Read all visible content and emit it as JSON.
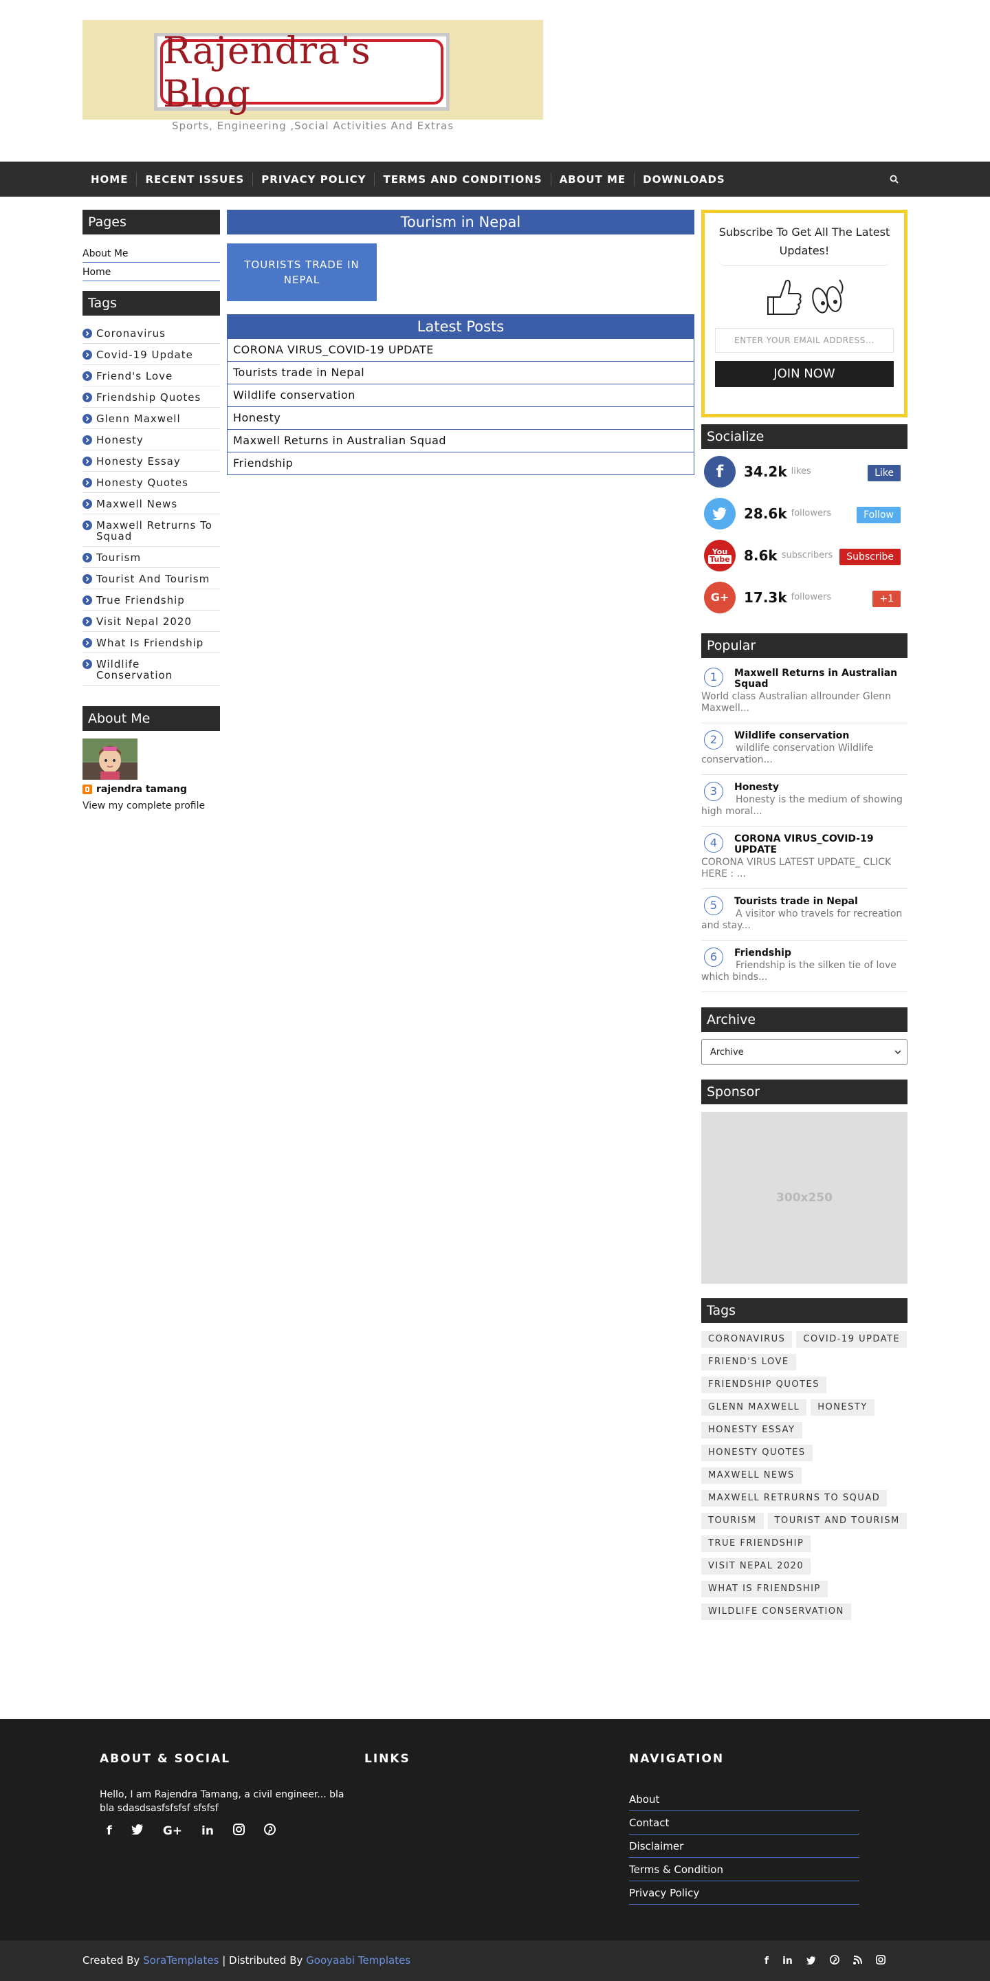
{
  "header": {
    "logo_text": "Rajendra's Blog",
    "tagline": "Sports, Engineering ,Social Activities And Extras"
  },
  "nav": {
    "items": [
      "HOME",
      "RECENT ISSUES",
      "PRIVACY POLICY",
      "TERMS AND CONDITIONS",
      "ABOUT ME",
      "DOWNLOADS"
    ],
    "search_icon": "search-icon"
  },
  "left": {
    "pages_title": "Pages",
    "pages": [
      "About Me",
      "Home"
    ],
    "tags_title": "Tags",
    "tags": [
      "Coronavirus",
      "Covid-19 Update",
      "Friend's Love",
      "Friendship Quotes",
      "Glenn Maxwell",
      "Honesty",
      "Honesty Essay",
      "Honesty Quotes",
      "Maxwell News",
      "Maxwell Retrurns To Squad",
      "Tourism",
      "Tourist And Tourism",
      "True Friendship",
      "Visit Nepal 2020",
      "What Is Friendship",
      "Wildlife Conservation"
    ],
    "about_title": "About Me",
    "profile_name": "rajendra tamang",
    "profile_link": "View my complete profile"
  },
  "center": {
    "title": "Tourism in Nepal",
    "post_card": "TOURISTS TRADE IN NEPAL",
    "latest_title": "Latest Posts",
    "latest": [
      "CORONA VIRUS_COVID-19 UPDATE",
      "Tourists trade in Nepal",
      "Wildlife conservation",
      "Honesty",
      "Maxwell Returns in Australian Squad",
      "Friendship"
    ]
  },
  "right": {
    "subscribe_text": "Subscribe To Get All The Latest Updates!",
    "email_placeholder": "ENTER YOUR EMAIL ADDRESS...",
    "join_label": "JOIN NOW",
    "socialize_title": "Socialize",
    "social": [
      {
        "icon": "facebook-icon",
        "count": "34.2k",
        "unit": "likes",
        "button": "Like",
        "color": "#3b5998",
        "btn_color": "#3b5998"
      },
      {
        "icon": "twitter-icon",
        "count": "28.6k",
        "unit": "followers",
        "button": "Follow",
        "color": "#55acee",
        "btn_color": "#55acee"
      },
      {
        "icon": "youtube-icon",
        "count": "8.6k",
        "unit": "subscribers",
        "button": "Subscribe",
        "color": "#cd201f",
        "btn_color": "#cd201f"
      },
      {
        "icon": "google-plus-icon",
        "count": "17.3k",
        "unit": "followers",
        "button": "+1",
        "color": "#dd4b39",
        "btn_color": "#dd4b39"
      }
    ],
    "popular_title": "Popular",
    "popular": [
      {
        "num": "1",
        "title": "Maxwell Returns in Australian Squad",
        "snippet": "World class Australian  allrounder Glenn Maxwell..."
      },
      {
        "num": "2",
        "title": "Wildlife conservation",
        "snippet": "wildlife conservation Wildlife conservation..."
      },
      {
        "num": "3",
        "title": "Honesty",
        "snippet": "Honesty is the medium of showing high moral..."
      },
      {
        "num": "4",
        "title": "CORONA VIRUS_COVID-19 UPDATE",
        "snippet": "CORONA VIRUS LATEST UPDATE_ CLICK HERE : ..."
      },
      {
        "num": "5",
        "title": "Tourists trade in Nepal",
        "snippet": "A visitor who travels for recreation and stay..."
      },
      {
        "num": "6",
        "title": "Friendship",
        "snippet": "Friendship is the silken tie of love which binds..."
      }
    ],
    "archive_title": "Archive",
    "archive_value": "Archive",
    "sponsor_title": "Sponsor",
    "sponsor_label": "300x250",
    "tags_title": "Tags",
    "tag_cloud": [
      "CORONAVIRUS",
      "COVID-19 UPDATE",
      "FRIEND'S LOVE",
      "FRIENDSHIP QUOTES",
      "GLENN MAXWELL",
      "HONESTY",
      "HONESTY ESSAY",
      "HONESTY QUOTES",
      "MAXWELL NEWS",
      "MAXWELL RETRURNS TO SQUAD",
      "TOURISM",
      "TOURIST AND TOURISM",
      "TRUE FRIENDSHIP",
      "VISIT NEPAL 2020",
      "WHAT IS FRIENDSHIP",
      "WILDLIFE CONSERVATION"
    ]
  },
  "footer": {
    "about_title": "ABOUT & SOCIAL",
    "about_text": "Hello, I am Rajendra Tamang, a civil engineer... bla bla sdasdsasfsfsfsf sfsfsf",
    "links_title": "LINKS",
    "nav_title": "NAVIGATION",
    "nav_links": [
      "About",
      "Contact",
      "Disclaimer",
      "Terms & Condition",
      "Privacy Policy"
    ],
    "credit_prefix": "Created By",
    "credit_link1": "SoraTemplates",
    "credit_sep": "| Distributed By",
    "credit_link2": "Gooyaabi Templates"
  },
  "colors": {
    "nav_bg": "#2e2e2e",
    "accent_blue": "#3c5ea8",
    "subscribe_border": "#f5cd2f",
    "footer_bg": "#1d1d1d"
  }
}
